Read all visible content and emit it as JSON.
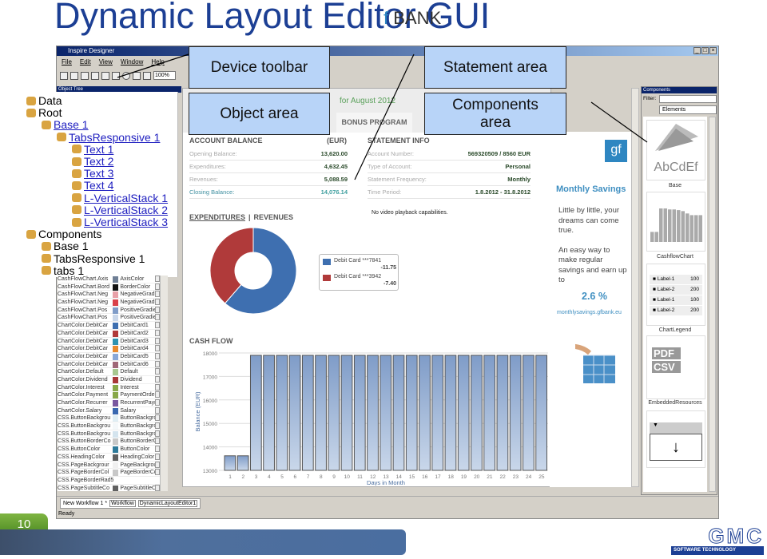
{
  "slide": {
    "title": "Dynamic Layout Editor GUI",
    "page_number": "10",
    "logo_text": "GMC",
    "logo_sub": "SOFTWARE TECHNOLOGY"
  },
  "callouts": {
    "device_toolbar": "Device toolbar",
    "statement_area": "Statement area",
    "object_area": "Object area",
    "components_area": "Components area"
  },
  "window": {
    "title": "Inspire Designer",
    "menu": [
      "File",
      "Edit",
      "View",
      "Window",
      "Help"
    ],
    "zoom": "100%",
    "object_tree_title": "Object Tree",
    "status": "Ready",
    "tabs": [
      "New Workflow 1 *",
      "Workflow",
      "DynamicLayoutEditor1"
    ]
  },
  "tree": [
    {
      "label": "Data",
      "depth": 0,
      "link": false,
      "icon": "data-icon"
    },
    {
      "label": "Root",
      "depth": 0,
      "link": false,
      "icon": "root-icon"
    },
    {
      "label": "Base 1",
      "depth": 1,
      "link": true
    },
    {
      "label": "TabsResponsive 1",
      "depth": 2,
      "link": true
    },
    {
      "label": "Text 1",
      "depth": 3,
      "link": true
    },
    {
      "label": "Text 2",
      "depth": 3,
      "link": true
    },
    {
      "label": "Text 3",
      "depth": 3,
      "link": true
    },
    {
      "label": "Text 4",
      "depth": 3,
      "link": true
    },
    {
      "label": "L-VerticalStack 1",
      "depth": 3,
      "link": true
    },
    {
      "label": "L-VerticalStack 2",
      "depth": 3,
      "link": true
    },
    {
      "label": "L-VerticalStack 3",
      "depth": 3,
      "link": true
    },
    {
      "label": "Components",
      "depth": 0,
      "link": false
    },
    {
      "label": "Base 1",
      "depth": 1,
      "link": false
    },
    {
      "label": "TabsResponsive 1",
      "depth": 1,
      "link": false
    },
    {
      "label": "tabs 1",
      "depth": 1,
      "link": false
    }
  ],
  "properties": [
    [
      "CashFlowChart.Axis",
      "#6f7f95",
      "AxisColor"
    ],
    [
      "CashFlowChart.Bord",
      "#111111",
      "BorderColor"
    ],
    [
      "CashFlowChart.Neg",
      "#e8a0a8",
      "NegativeGradi"
    ],
    [
      "CashFlowChart.Neg",
      "#d9414a",
      "NegativeGradi"
    ],
    [
      "CashFlowChart.Pos",
      "#7f9cc8",
      "PositiveGradie"
    ],
    [
      "CashFlowChart.Pos",
      "#c9d7ea",
      "PositiveGradie"
    ],
    [
      "ChartColor.DebitCar",
      "#3e6fb0",
      "DebitCard1"
    ],
    [
      "ChartColor.DebitCar",
      "#b03a3a",
      "DebitCard2"
    ],
    [
      "ChartColor.DebitCar",
      "#2f93b0",
      "DebitCard3"
    ],
    [
      "ChartColor.DebitCar",
      "#e88a2e",
      "DebitCard4"
    ],
    [
      "ChartColor.DebitCar",
      "#88a8d8",
      "DebitCard5"
    ],
    [
      "ChartColor.DebitCar",
      "#a06878",
      "DebitCard6"
    ],
    [
      "ChartColor.Default",
      "#a8c890",
      "Default"
    ],
    [
      "ChartColor.Dividend",
      "#a83838",
      "Dividend"
    ],
    [
      "ChartColor.Interest",
      "#88a848",
      "Interest"
    ],
    [
      "ChartColor.Payment",
      "#88a848",
      "PaymentOrder"
    ],
    [
      "ChartColor.Recurrer",
      "#7a58a0",
      "RecurrentPayr"
    ],
    [
      "ChartColor.Salary",
      "#3a68b0",
      "Salary"
    ],
    [
      "CSS.ButtonBackgrou",
      "#e0eef4",
      "ButtonBackgrc"
    ],
    [
      "CSS.ButtonBackgrou",
      "#f4f8fa",
      "ButtonBackgrc"
    ],
    [
      "CSS.ButtonBackgrou",
      "#d4e4ee",
      "ButtonBackgrc"
    ],
    [
      "CSS.ButtonBorderCo",
      "#c8c8c8",
      "ButtonBorderC"
    ],
    [
      "CSS.ButtonColor",
      "#2e7a9a",
      "ButtonColor"
    ],
    [
      "CSS.HeadingColor",
      "#606060",
      "HeadingColor"
    ],
    [
      "CSS.PageBackgrour",
      "#f0f0f0",
      "PageBackgrou"
    ],
    [
      "CSS.PageBorderCol",
      "#c8c8c8",
      "PageBorderCo"
    ],
    [
      "CSS.PageBorderRad5",
      "",
      ""
    ],
    [
      "CSS.PageSubtitleCo",
      "#606060",
      "PageSubtitleC"
    ]
  ],
  "statement": {
    "header_month": "for August 2012",
    "bank_prefix": "f",
    "bank": "BANK",
    "tab": "BONUS PROGRAM",
    "account_balance": {
      "title": "ACCOUNT BALANCE",
      "currency": "(EUR)",
      "rows": [
        [
          "Opening Balance:",
          "13,620.00"
        ],
        [
          "Expenditures:",
          "4,632.45"
        ],
        [
          "Revenues:",
          "5,088.59"
        ],
        [
          "Closing Balance:",
          "14,076.14"
        ]
      ]
    },
    "statement_info": {
      "title": "STATEMENT INFO",
      "rows": [
        [
          "Account Number:",
          "569320509 / 8560 EUR"
        ],
        [
          "Type of Account:",
          "Personal"
        ],
        [
          "Statement Frequency:",
          "Monthly"
        ],
        [
          "Time Period:",
          "1.8.2012 - 31.8.2012"
        ]
      ]
    },
    "video_msg": "No video playback capabilities.",
    "exp_tab": "EXPENDITURES",
    "rev_tab": "REVENUES",
    "sep": "|",
    "cashflow_title": "CASH FLOW"
  },
  "chart_data": [
    {
      "type": "pie",
      "donut": true,
      "slices": [
        {
          "name": "Debit Card ***7841",
          "value": 11.75,
          "label": "-11.75",
          "color": "#3e6fb0"
        },
        {
          "name": "Debit Card ***3942",
          "value": 7.4,
          "label": "-7.40",
          "color": "#b03a3a"
        }
      ]
    },
    {
      "type": "bar",
      "title": "CASH FLOW",
      "xlabel": "Days in Month",
      "ylabel": "Balance (EUR)",
      "ylim": [
        13000,
        18000
      ],
      "yticks": [
        13000,
        14000,
        15000,
        16000,
        17000,
        18000
      ],
      "categories": [
        "1",
        "2",
        "3",
        "4",
        "5",
        "6",
        "7",
        "8",
        "9",
        "10",
        "11",
        "12",
        "13",
        "14",
        "15",
        "16",
        "17",
        "18",
        "19",
        "20",
        "21",
        "22",
        "23",
        "24",
        "25"
      ],
      "values": [
        13620,
        13620,
        17900,
        17900,
        17900,
        17900,
        17900,
        17900,
        17900,
        17900,
        17900,
        17900,
        17900,
        17900,
        17900,
        17900,
        17900,
        17900,
        17900,
        17900,
        17900,
        17900,
        17900,
        17900,
        17900
      ],
      "grid": true
    }
  ],
  "banner": {
    "logo": "gf",
    "title": "Monthly Savings",
    "text": "Little by little, your dreams can come true.",
    "text2": "An easy way to make regular savings and earn up to",
    "rate": "2.6 %",
    "url": "monthlysavings.gfbank.eu"
  },
  "components": {
    "title": "Components",
    "filter_label": "Filter:",
    "filter_value": "",
    "category": "Elements",
    "items": [
      "Base",
      "CashflowChart",
      "ChartLegend",
      "EmbeddedResources"
    ],
    "base_sample": "AbCdEf",
    "embedded_labels": [
      "PDF",
      "CSV"
    ],
    "legend_rows": [
      [
        "Label-1",
        "100"
      ],
      [
        "Label-2",
        "200"
      ],
      [
        "Label-1",
        "100"
      ],
      [
        "Label-2",
        "200"
      ]
    ]
  },
  "colors": {
    "callout": "#b8d4f8",
    "title": "#1c3f94",
    "accent": "#3f8fc1"
  }
}
